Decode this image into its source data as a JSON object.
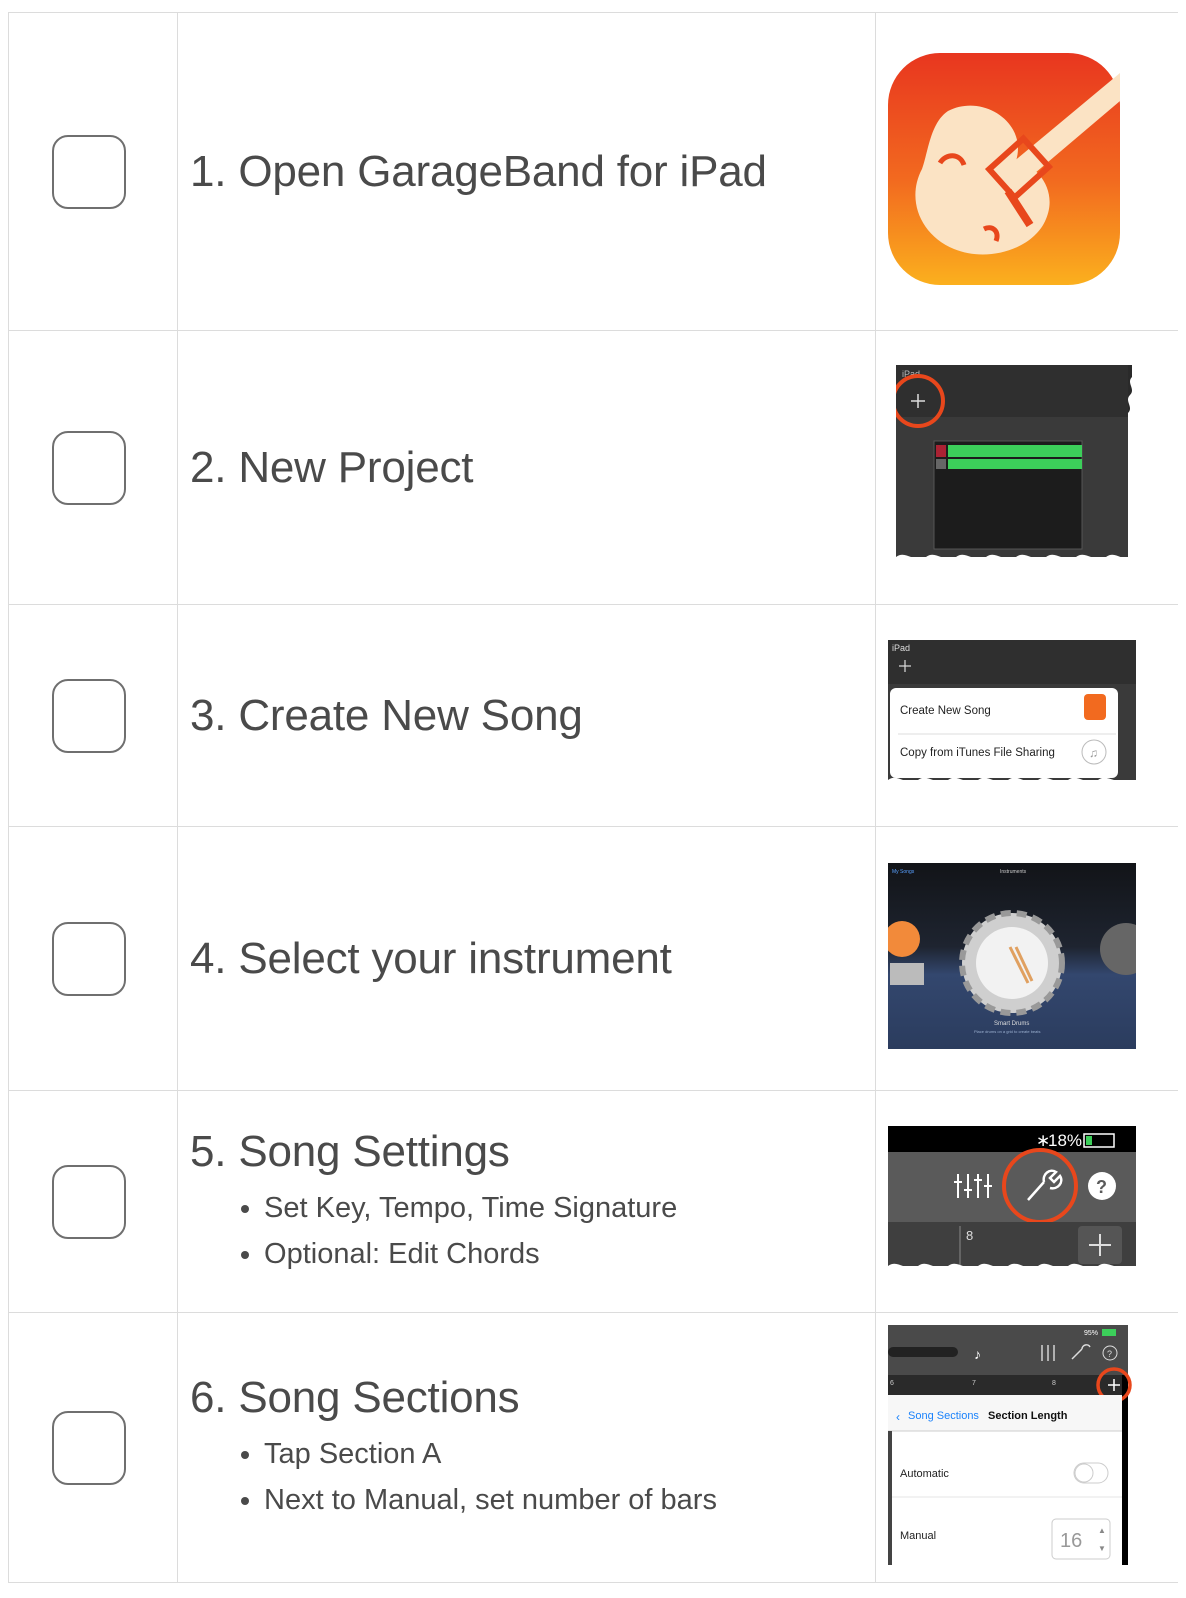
{
  "steps": [
    {
      "number_label": "1. Open GarageBand for iPad",
      "bullets": []
    },
    {
      "number_label": "2. New Project",
      "bullets": []
    },
    {
      "number_label": "3. Create New Song",
      "bullets": []
    },
    {
      "number_label": "4. Select your instrument",
      "bullets": []
    },
    {
      "number_label": "5. Song Settings",
      "bullets": [
        "Set Key, Tempo, Time Signature",
        "Optional: Edit Chords"
      ]
    },
    {
      "number_label": "6. Song Sections",
      "bullets": [
        "Tap Section A",
        "Next to Manual, set number of bars"
      ]
    }
  ],
  "screens": {
    "new_project": {
      "status": "iPad"
    },
    "create_song": {
      "status": "iPad",
      "menu_items": [
        "Create New Song",
        "Copy from iTunes File Sharing"
      ]
    },
    "instrument": {
      "back_label": "My Songs",
      "title": "Instruments",
      "instrument_name": "Smart Drums",
      "instrument_desc": "Place drums on a grid to create beats"
    },
    "settings": {
      "battery": "18%",
      "ruler_bar": "8"
    },
    "sections": {
      "battery": "95%",
      "ruler_labels": [
        "6",
        "7",
        "8"
      ],
      "back_label": "Song Sections",
      "title": "Section Length",
      "automatic_label": "Automatic",
      "manual_label": "Manual",
      "manual_value": "16"
    }
  },
  "colors": {
    "accent_red": "#e8471c",
    "ios_blue": "#1a82fb",
    "track_green": "#3ccf5a"
  }
}
